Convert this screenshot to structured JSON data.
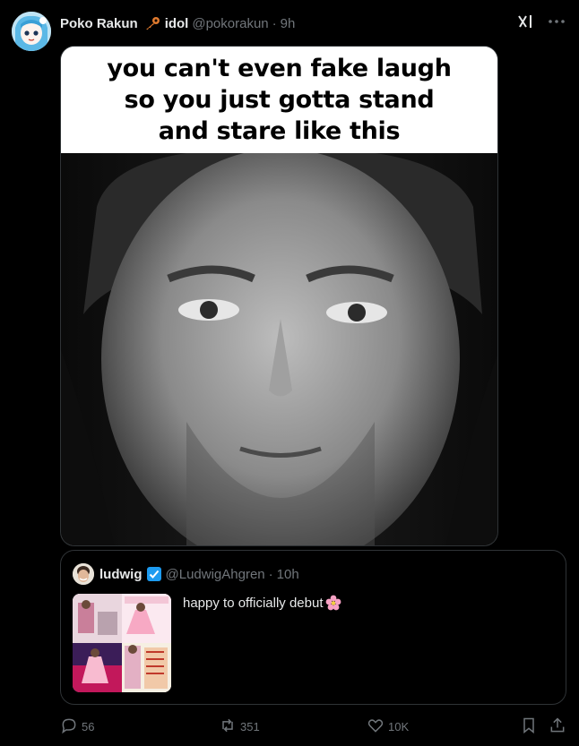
{
  "post": {
    "author_name": "Poko Rakun",
    "badge_icon": "key-icon",
    "tag": "idol",
    "handle": "@pokorakun",
    "separator": "·",
    "time": "9h"
  },
  "media": {
    "caption_lines": [
      "you can't even fake laugh",
      "so you just gotta stand",
      "and stare like this"
    ]
  },
  "quote": {
    "author_name": "ludwig",
    "verified_icon": "verified-badge-icon",
    "handle": "@LudwigAhgren",
    "separator": "·",
    "time": "10h",
    "text": "happy to officially debut",
    "emoji_icon": "cherry-blossom-icon"
  },
  "actions": {
    "replies": "56",
    "reposts": "351",
    "likes": "10K"
  },
  "colors": {
    "background": "#000000",
    "text_primary": "#e7e9ea",
    "text_secondary": "#71767b",
    "border": "#2f3336",
    "verified_blue": "#1d9bf0"
  }
}
